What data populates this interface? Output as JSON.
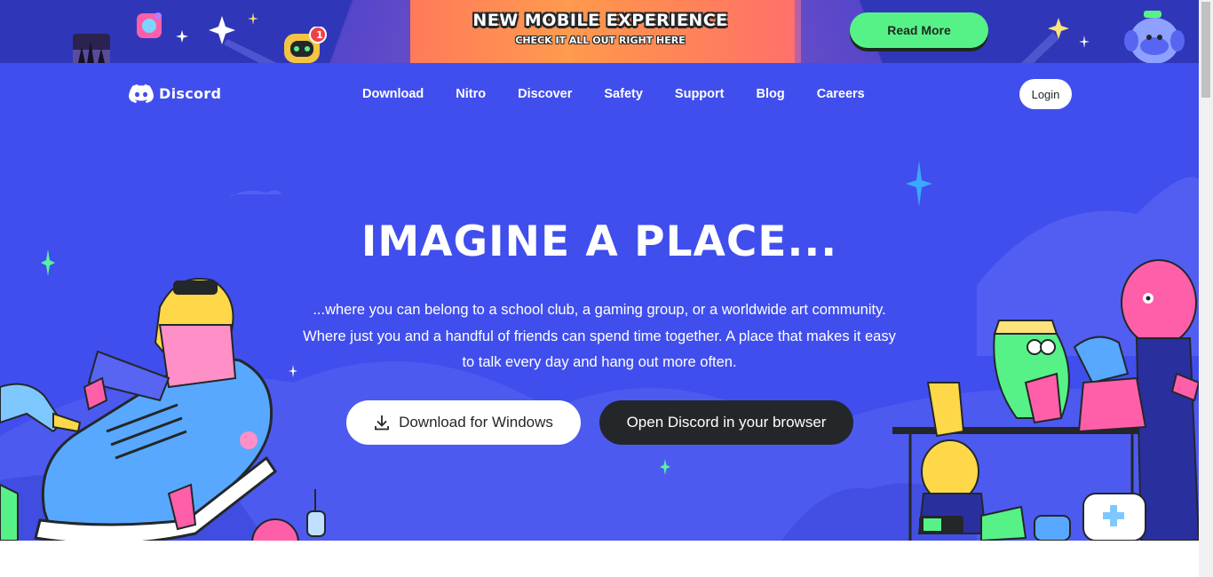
{
  "promo": {
    "title": "NEW MOBILE EXPERIENCE",
    "subtitle": "CHECK IT ALL OUT RIGHT HERE",
    "cta_label": "Read More",
    "notification_count": "1"
  },
  "header": {
    "logo_text": "Discord",
    "nav_items": [
      "Download",
      "Nitro",
      "Discover",
      "Safety",
      "Support",
      "Blog",
      "Careers"
    ],
    "login_label": "Login"
  },
  "hero": {
    "headline": "IMAGINE A PLACE...",
    "lead_lines": [
      "...where you can belong to a school club, a gaming group, or a worldwide art community.",
      "Where just you and a handful of friends can spend time together. A place that makes it easy",
      "to talk every day and hang out more often."
    ],
    "download_label": "Download for Windows",
    "browser_label": "Open Discord in your browser"
  },
  "colors": {
    "blurple": "#404eed",
    "banner": "#2f37b8",
    "green": "#57f287",
    "dark": "#23272a"
  },
  "icons": {
    "logo": "discord-logo-icon",
    "download": "download-icon"
  }
}
